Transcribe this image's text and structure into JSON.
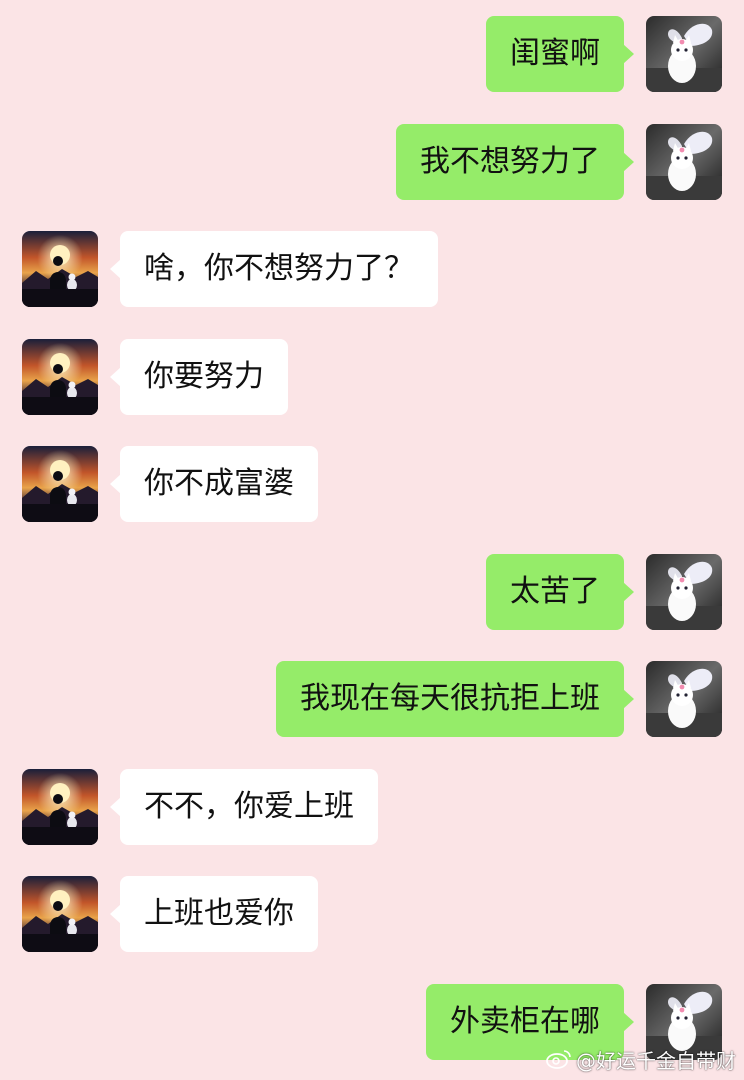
{
  "colors": {
    "background": "#fbe4e6",
    "self_bubble": "#95ec69",
    "other_bubble": "#ffffff"
  },
  "icons": {
    "self_avatar": "white-kitten-with-butterfly-wings-avatar",
    "other_avatar": "silhouette-person-and-cat-sunset-avatar",
    "watermark": "weibo-logo-icon"
  },
  "messages": [
    {
      "side": "right",
      "text": "闺蜜啊"
    },
    {
      "side": "right",
      "text": "我不想努力了"
    },
    {
      "side": "left",
      "text": "啥，你不想努力了？"
    },
    {
      "side": "left",
      "text": "你要努力"
    },
    {
      "side": "left",
      "text": "你不成富婆"
    },
    {
      "side": "right",
      "text": "太苦了"
    },
    {
      "side": "right",
      "text": "我现在每天很抗拒上班"
    },
    {
      "side": "left",
      "text": "不不，你爱上班"
    },
    {
      "side": "left",
      "text": "上班也爱你"
    },
    {
      "side": "right",
      "text": "外卖柜在哪"
    }
  ],
  "watermark": {
    "text": "@好运千金自带财"
  }
}
